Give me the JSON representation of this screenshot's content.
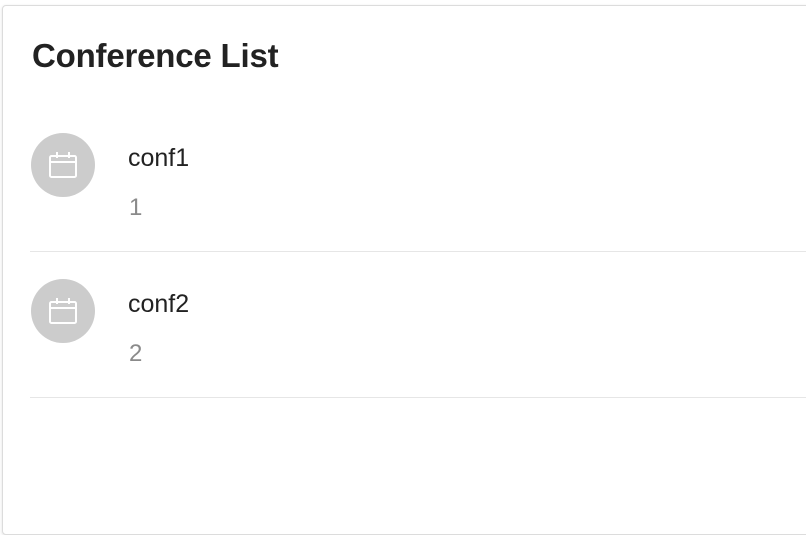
{
  "header": {
    "title": "Conference List"
  },
  "conferences": [
    {
      "name": "conf1",
      "id": "1",
      "icon": "calendar-icon"
    },
    {
      "name": "conf2",
      "id": "2",
      "icon": "calendar-icon"
    }
  ],
  "colors": {
    "title": "#222222",
    "subtitle": "#8a8a8a",
    "avatar_bg": "#cccccc",
    "divider": "#e6e6e6"
  }
}
